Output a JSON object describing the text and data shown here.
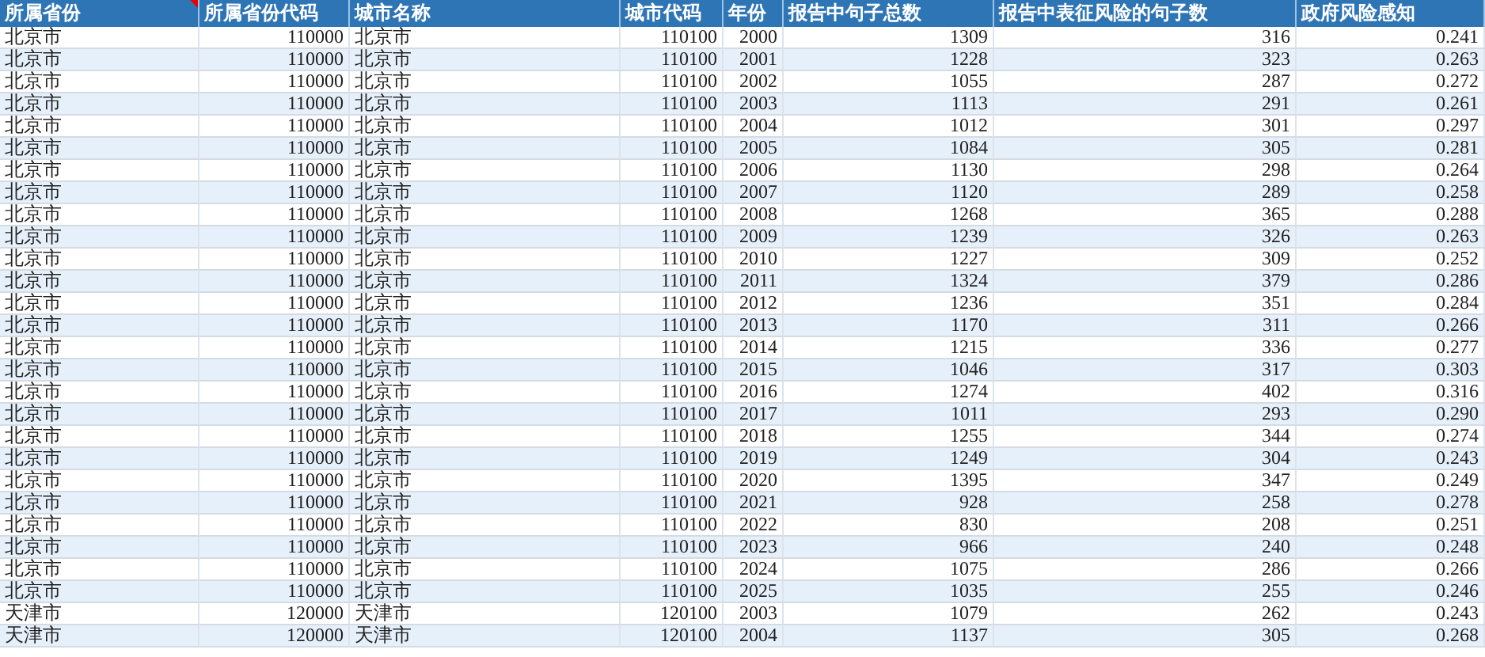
{
  "table": {
    "columns": [
      {
        "label": "所属省份",
        "kind": "text",
        "has_comment": true
      },
      {
        "label": "所属省份代码",
        "kind": "number",
        "has_comment": false
      },
      {
        "label": "城市名称",
        "kind": "text",
        "has_comment": false
      },
      {
        "label": "城市代码",
        "kind": "number",
        "has_comment": false
      },
      {
        "label": "年份",
        "kind": "number",
        "has_comment": false
      },
      {
        "label": "报告中句子总数",
        "kind": "number",
        "has_comment": false
      },
      {
        "label": "报告中表征风险的句子数",
        "kind": "number",
        "has_comment": false
      },
      {
        "label": "政府风险感知",
        "kind": "number",
        "has_comment": false
      }
    ],
    "rows": [
      [
        "北京市",
        "110000",
        "北京市",
        "110100",
        "2000",
        "1309",
        "316",
        "0.241"
      ],
      [
        "北京市",
        "110000",
        "北京市",
        "110100",
        "2001",
        "1228",
        "323",
        "0.263"
      ],
      [
        "北京市",
        "110000",
        "北京市",
        "110100",
        "2002",
        "1055",
        "287",
        "0.272"
      ],
      [
        "北京市",
        "110000",
        "北京市",
        "110100",
        "2003",
        "1113",
        "291",
        "0.261"
      ],
      [
        "北京市",
        "110000",
        "北京市",
        "110100",
        "2004",
        "1012",
        "301",
        "0.297"
      ],
      [
        "北京市",
        "110000",
        "北京市",
        "110100",
        "2005",
        "1084",
        "305",
        "0.281"
      ],
      [
        "北京市",
        "110000",
        "北京市",
        "110100",
        "2006",
        "1130",
        "298",
        "0.264"
      ],
      [
        "北京市",
        "110000",
        "北京市",
        "110100",
        "2007",
        "1120",
        "289",
        "0.258"
      ],
      [
        "北京市",
        "110000",
        "北京市",
        "110100",
        "2008",
        "1268",
        "365",
        "0.288"
      ],
      [
        "北京市",
        "110000",
        "北京市",
        "110100",
        "2009",
        "1239",
        "326",
        "0.263"
      ],
      [
        "北京市",
        "110000",
        "北京市",
        "110100",
        "2010",
        "1227",
        "309",
        "0.252"
      ],
      [
        "北京市",
        "110000",
        "北京市",
        "110100",
        "2011",
        "1324",
        "379",
        "0.286"
      ],
      [
        "北京市",
        "110000",
        "北京市",
        "110100",
        "2012",
        "1236",
        "351",
        "0.284"
      ],
      [
        "北京市",
        "110000",
        "北京市",
        "110100",
        "2013",
        "1170",
        "311",
        "0.266"
      ],
      [
        "北京市",
        "110000",
        "北京市",
        "110100",
        "2014",
        "1215",
        "336",
        "0.277"
      ],
      [
        "北京市",
        "110000",
        "北京市",
        "110100",
        "2015",
        "1046",
        "317",
        "0.303"
      ],
      [
        "北京市",
        "110000",
        "北京市",
        "110100",
        "2016",
        "1274",
        "402",
        "0.316"
      ],
      [
        "北京市",
        "110000",
        "北京市",
        "110100",
        "2017",
        "1011",
        "293",
        "0.290"
      ],
      [
        "北京市",
        "110000",
        "北京市",
        "110100",
        "2018",
        "1255",
        "344",
        "0.274"
      ],
      [
        "北京市",
        "110000",
        "北京市",
        "110100",
        "2019",
        "1249",
        "304",
        "0.243"
      ],
      [
        "北京市",
        "110000",
        "北京市",
        "110100",
        "2020",
        "1395",
        "347",
        "0.249"
      ],
      [
        "北京市",
        "110000",
        "北京市",
        "110100",
        "2021",
        "928",
        "258",
        "0.278"
      ],
      [
        "北京市",
        "110000",
        "北京市",
        "110100",
        "2022",
        "830",
        "208",
        "0.251"
      ],
      [
        "北京市",
        "110000",
        "北京市",
        "110100",
        "2023",
        "966",
        "240",
        "0.248"
      ],
      [
        "北京市",
        "110000",
        "北京市",
        "110100",
        "2024",
        "1075",
        "286",
        "0.266"
      ],
      [
        "北京市",
        "110000",
        "北京市",
        "110100",
        "2025",
        "1035",
        "255",
        "0.246"
      ],
      [
        "天津市",
        "120000",
        "天津市",
        "120100",
        "2003",
        "1079",
        "262",
        "0.243"
      ],
      [
        "天津市",
        "120000",
        "天津市",
        "120100",
        "2004",
        "1137",
        "305",
        "0.268"
      ]
    ]
  }
}
